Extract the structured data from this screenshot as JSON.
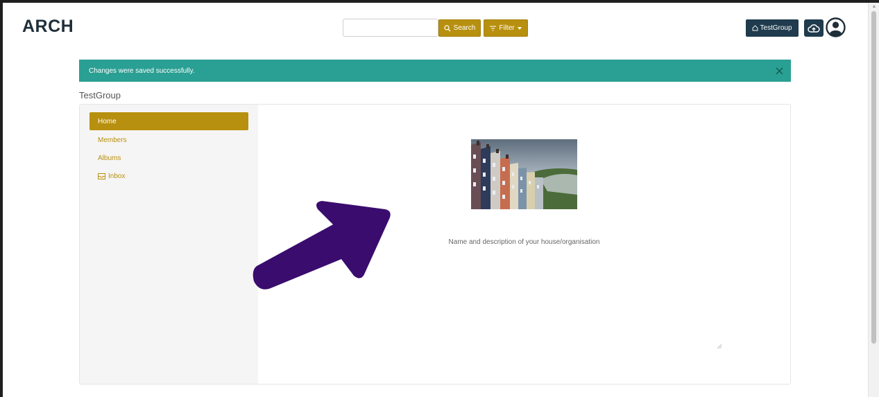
{
  "header": {
    "logo": "ARCH",
    "search_placeholder": "",
    "search_label": "Search",
    "filter_label": "Filter",
    "group_label": "TestGroup"
  },
  "alert": {
    "message": "Changes were saved successfully."
  },
  "group": {
    "title": "TestGroup"
  },
  "sidebar": {
    "items": [
      {
        "label": "Home",
        "active": true
      },
      {
        "label": "Members",
        "active": false
      },
      {
        "label": "Albums",
        "active": false
      },
      {
        "label": "Inbox",
        "active": false
      }
    ]
  },
  "main": {
    "description": "Name and description of your house/organisation"
  },
  "colors": {
    "accent": "#b8900f",
    "navy": "#1f3b4d",
    "success": "#2a9f93",
    "arrow": "#3a0c6e"
  },
  "icons": [
    "search-icon",
    "filter-icon",
    "caret-down-icon",
    "home-icon",
    "cloud-upload-icon",
    "user-circle-icon",
    "close-icon",
    "inbox-icon",
    "resize-handle-icon",
    "arrow-annotation"
  ]
}
